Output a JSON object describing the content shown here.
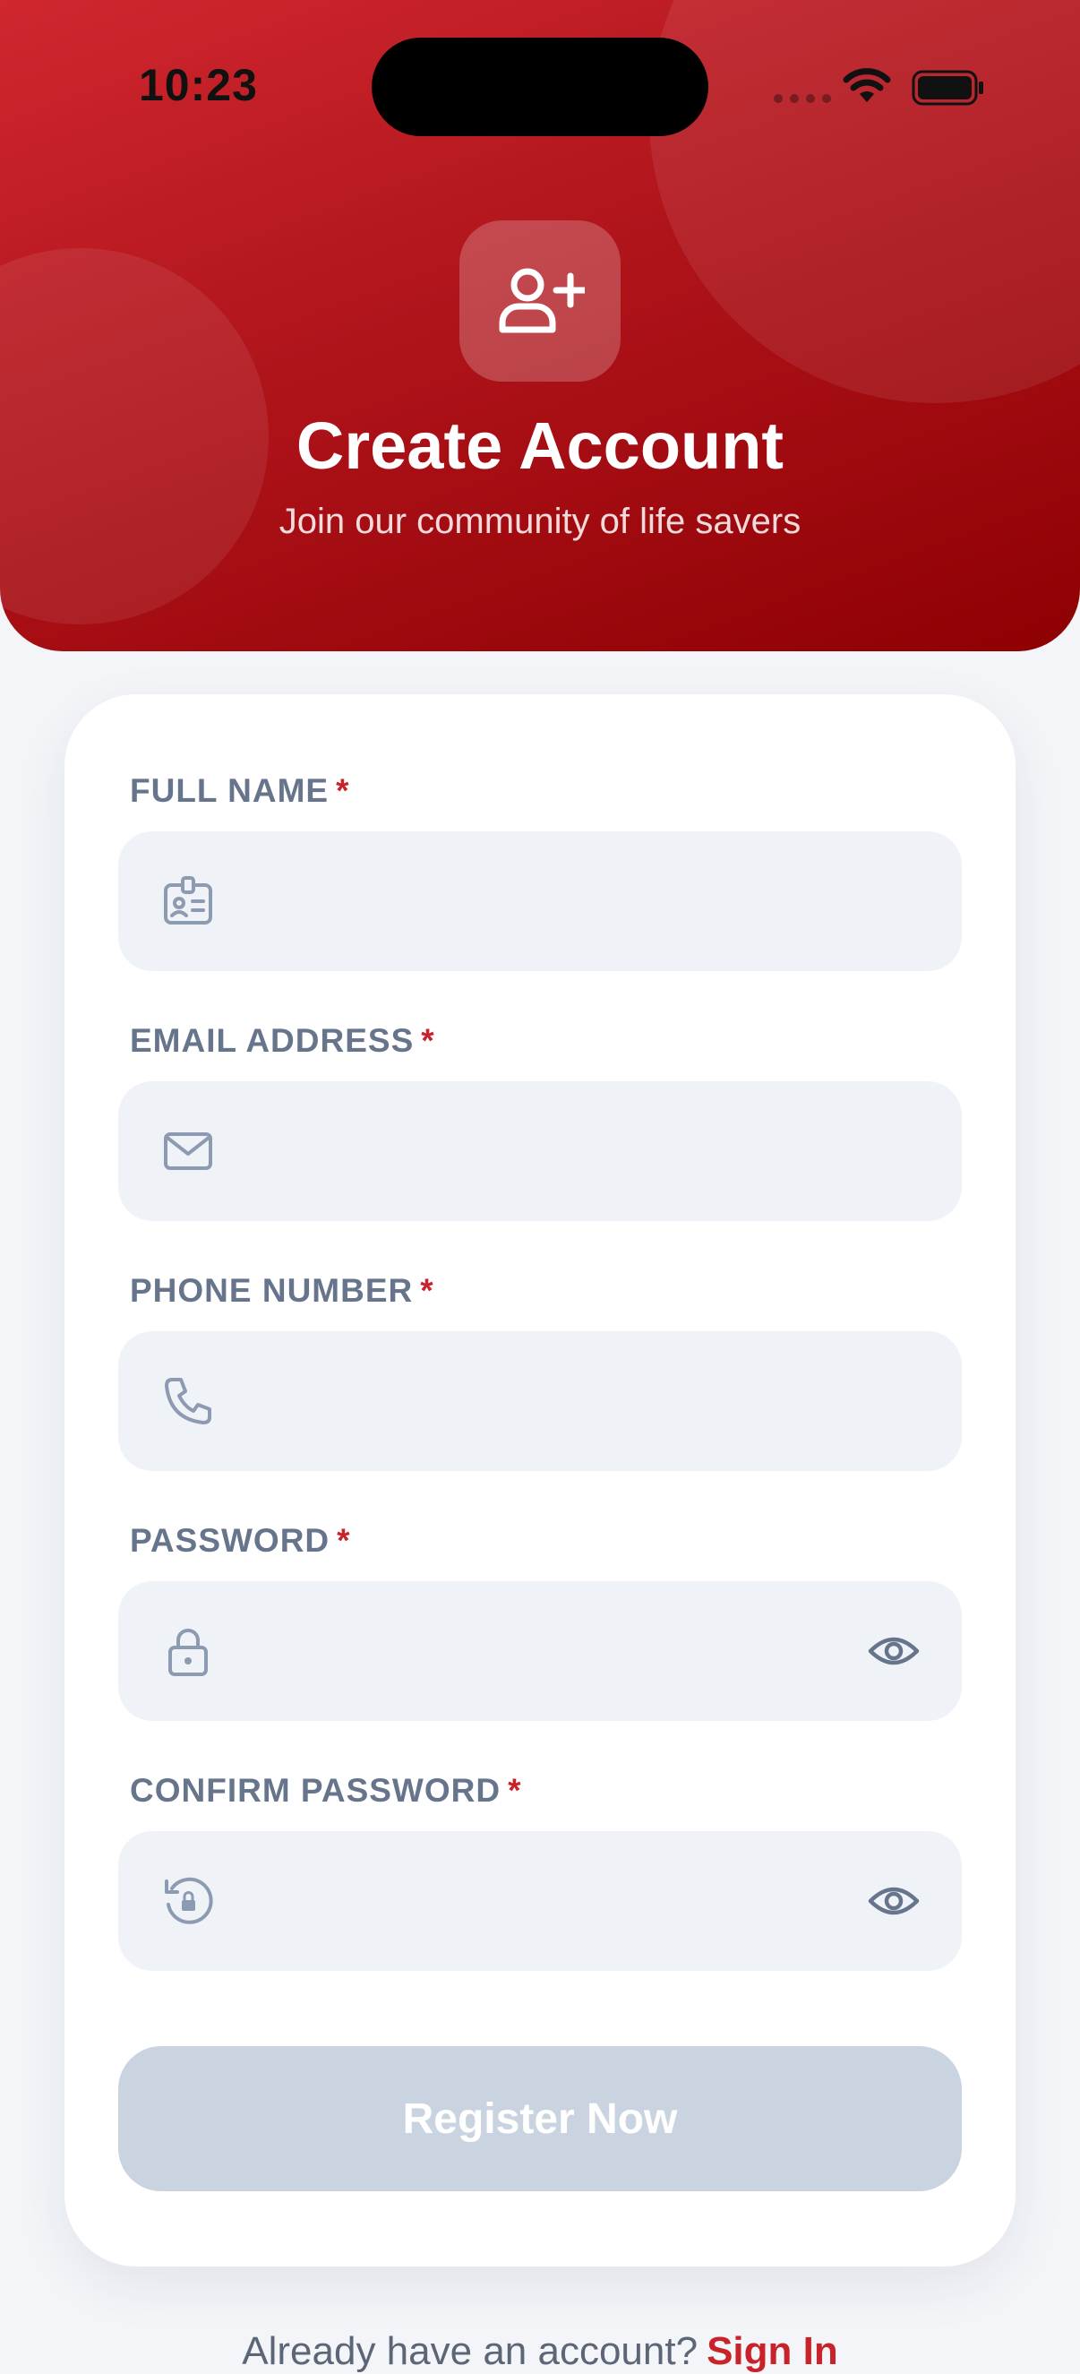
{
  "status_bar": {
    "time": "10:23"
  },
  "header": {
    "title": "Create Account",
    "subtitle": "Join our community of life savers"
  },
  "form": {
    "fields": [
      {
        "label": "FULL NAME",
        "required_mark": "*",
        "value": "",
        "icon": "id-badge-icon"
      },
      {
        "label": "EMAIL ADDRESS",
        "required_mark": "*",
        "value": "",
        "icon": "mail-icon"
      },
      {
        "label": "PHONE NUMBER",
        "required_mark": "*",
        "value": "",
        "icon": "phone-icon"
      },
      {
        "label": "PASSWORD",
        "required_mark": "*",
        "value": "",
        "icon": "lock-icon"
      },
      {
        "label": "CONFIRM PASSWORD",
        "required_mark": "*",
        "value": "",
        "icon": "lock-reset-icon"
      }
    ],
    "submit_label": "Register Now"
  },
  "footer": {
    "prompt": "Already have an account?",
    "link": "Sign In"
  },
  "colors": {
    "brand": "#c8232b",
    "header_dark": "#8e0003",
    "button_disabled": "#cad4e1",
    "input_bg": "#eff3f8",
    "label": "#66758c"
  }
}
